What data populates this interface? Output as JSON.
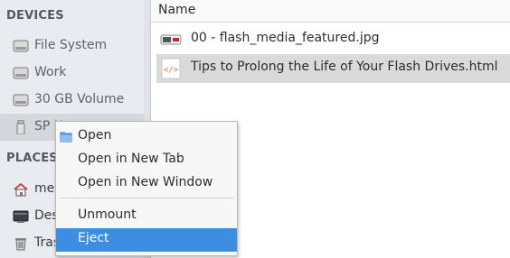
{
  "sidebar": {
    "devices_heading": "DEVICES",
    "places_heading": "PLACES",
    "devices": [
      {
        "label": "File System",
        "icon": "hard-drive-icon"
      },
      {
        "label": "Work",
        "icon": "hard-drive-icon"
      },
      {
        "label": "30 GB Volume",
        "icon": "hard-drive-icon"
      },
      {
        "label": "SP U",
        "icon": "usb-drive-icon"
      }
    ],
    "places": [
      {
        "label": "me",
        "icon": "home-icon"
      },
      {
        "label": "Des",
        "icon": "desktop-icon"
      },
      {
        "label": "Tras",
        "icon": "trash-icon"
      }
    ]
  },
  "main": {
    "column_header": "Name",
    "files": [
      {
        "name": "00 - flash_media_featured.jpg",
        "icon": "image-file-icon"
      },
      {
        "name": "Tips to Prolong the Life of Your Flash Drives.html",
        "icon": "html-file-icon"
      }
    ]
  },
  "context_menu": {
    "items": [
      {
        "label": "Open",
        "icon": "folder-icon"
      },
      {
        "label": "Open in New Tab"
      },
      {
        "label": "Open in New Window"
      },
      {
        "label": "Unmount"
      },
      {
        "label": "Eject"
      }
    ],
    "highlight_color": "#3d8ee2"
  }
}
